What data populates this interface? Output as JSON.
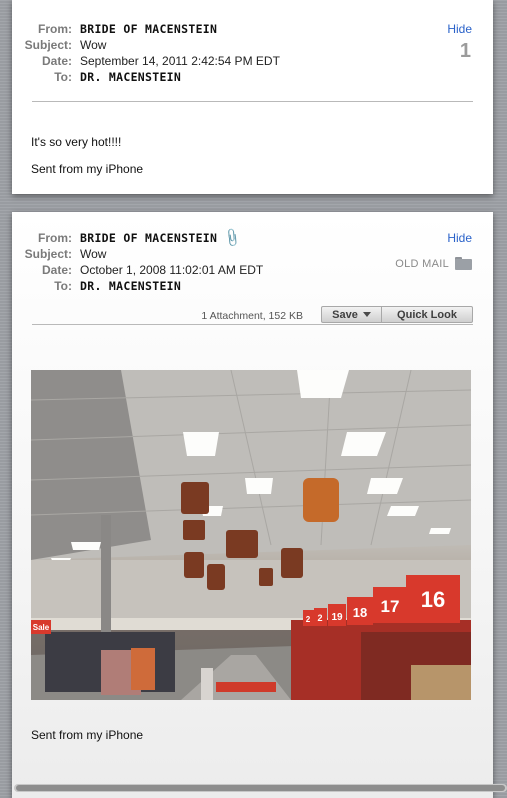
{
  "message1": {
    "labels": {
      "from": "From:",
      "subject": "Subject:",
      "date": "Date:",
      "to": "To:"
    },
    "from": "BRIDE OF MACENSTEIN",
    "subject": "Wow",
    "date": "September 14, 2011 2:42:54 PM EDT",
    "to": "DR. MACENSTEIN",
    "hide_label": "Hide",
    "count": "1",
    "body": [
      "It's so very hot!!!!",
      "Sent from my iPhone"
    ]
  },
  "message2": {
    "labels": {
      "from": "From:",
      "subject": "Subject:",
      "date": "Date:",
      "to": "To:"
    },
    "from": "BRIDE OF MACENSTEIN",
    "subject": "Wow",
    "date": "October 1, 2008 11:02:01 AM EDT",
    "to": "DR. MACENSTEIN",
    "hide_label": "Hide",
    "mailbox": "OLD MAIL",
    "attachment_info": "1 Attachment, 152 KB",
    "save_label": "Save",
    "quicklook_label": "Quick Look",
    "signature": "Sent from my iPhone",
    "photo_signs": [
      "16",
      "17",
      "18",
      "19",
      "2",
      "2",
      "Sale"
    ]
  },
  "icons": {
    "attachment": "paperclip-icon",
    "mailbox": "folder-icon",
    "save_menu": "triangle-down-icon"
  },
  "colors": {
    "link": "#2a62c9",
    "label": "#7a7a7a",
    "sign_red": "#d8392c"
  }
}
